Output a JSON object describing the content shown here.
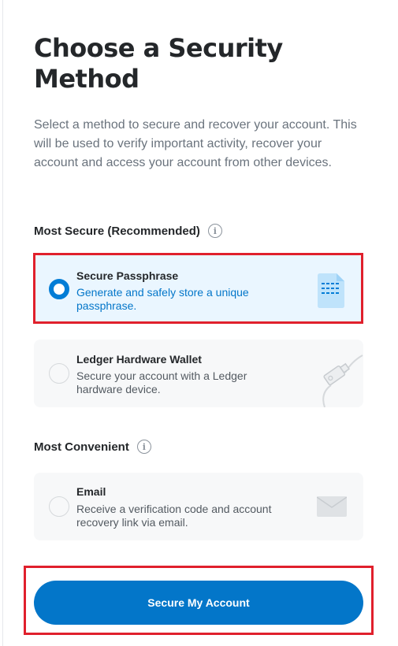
{
  "title": "Choose a Security Method",
  "description": "Select a method to secure and recover your account. This will be used to verify important activity, recover your account and access your account from other devices.",
  "sections": {
    "secure": {
      "label": "Most Secure (Recommended)",
      "info_icon": "info-icon"
    },
    "convenient": {
      "label": "Most Convenient",
      "info_icon": "info-icon"
    }
  },
  "options": {
    "passphrase": {
      "title": "Secure Passphrase",
      "description": "Generate and safely store a unique passphrase.",
      "selected": true,
      "icon": "document-icon"
    },
    "ledger": {
      "title": "Ledger Hardware Wallet",
      "description": "Secure your account with a Ledger hardware device.",
      "selected": false,
      "icon": "usb-device-icon"
    },
    "email": {
      "title": "Email",
      "description": "Receive a verification code and account recovery link via email.",
      "selected": false,
      "icon": "envelope-icon"
    }
  },
  "cta": {
    "label": "Secure My Account"
  },
  "colors": {
    "accent": "#037dd6",
    "button": "#0376c9",
    "selected_bg": "#eaf6ff",
    "highlight": "#e0202c"
  }
}
